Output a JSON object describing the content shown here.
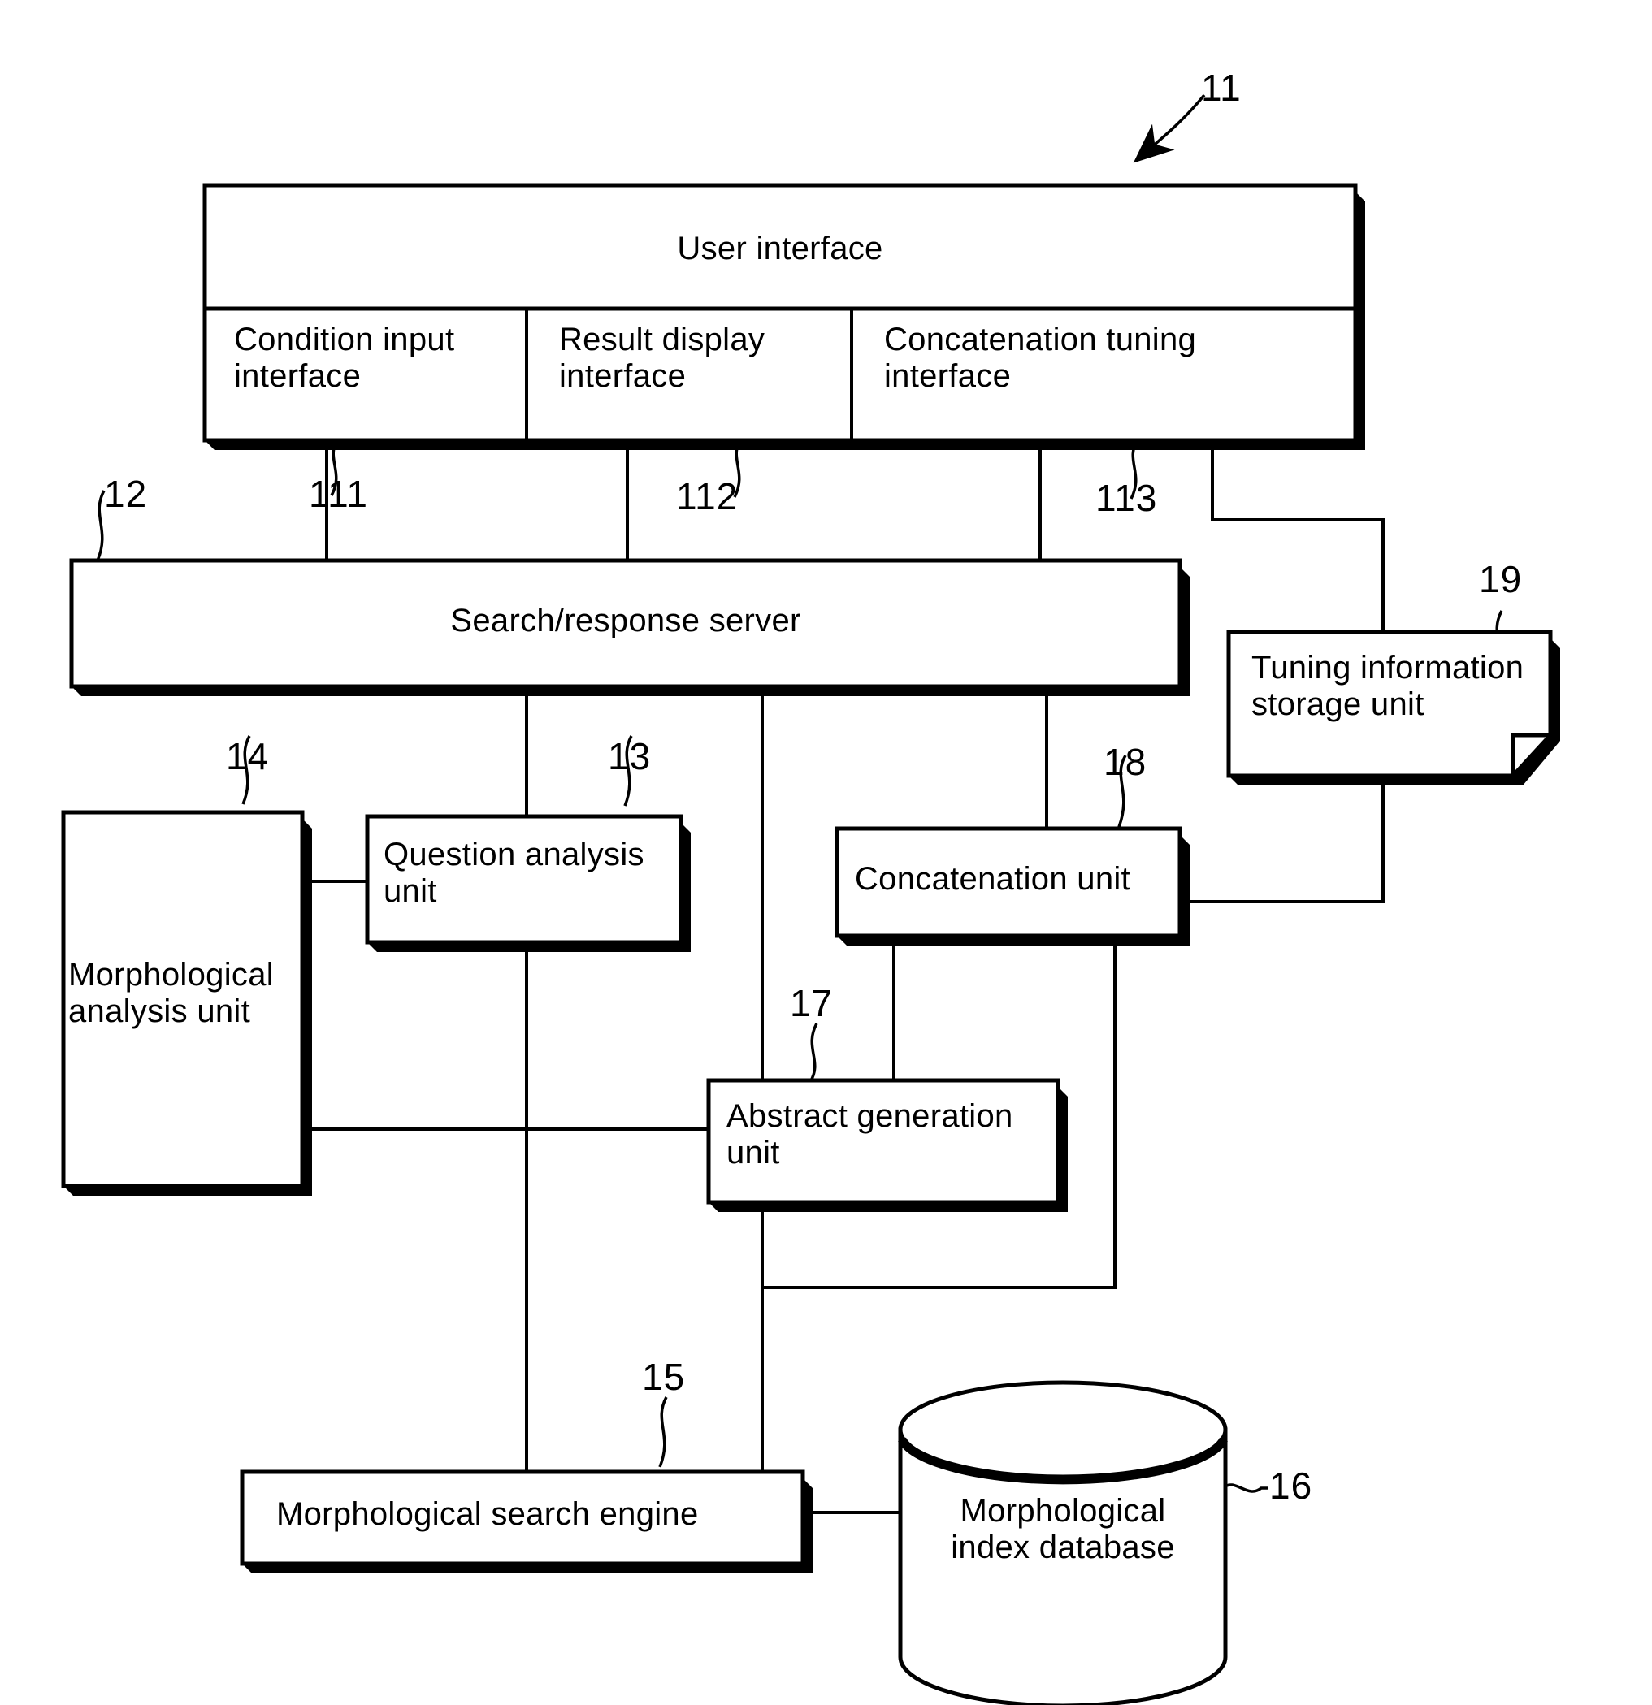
{
  "figure": {
    "title": "Search and response system block diagram",
    "line_color": "#000000",
    "background": "#ffffff"
  },
  "blocks": {
    "user_interface": {
      "label": "User interface",
      "ref": "11"
    },
    "condition_input_interface": {
      "label": "Condition input\ninterface",
      "ref": "111"
    },
    "result_display_interface": {
      "label": "Result display\ninterface",
      "ref": "112"
    },
    "concatenation_tuning_interface": {
      "label": "Concatenation tuning\ninterface",
      "ref": "113"
    },
    "search_response_server": {
      "label": "Search/response server",
      "ref": "12"
    },
    "tuning_information_storage_unit": {
      "label": "Tuning information\nstorage unit",
      "ref": "19"
    },
    "question_analysis_unit": {
      "label": "Question analysis\nunit",
      "ref": "13"
    },
    "morphological_analysis_unit": {
      "label": "Morphological\nanalysis unit",
      "ref": "14"
    },
    "concatenation_unit": {
      "label": "Concatenation unit",
      "ref": "18"
    },
    "abstract_generation_unit": {
      "label": "Abstract generation\nunit",
      "ref": "17"
    },
    "morphological_search_engine": {
      "label": "Morphological search engine",
      "ref": "15"
    },
    "morphological_index_database": {
      "label": "Morphological\nindex database",
      "ref": "16"
    }
  },
  "reference_numerals": {
    "n11": "11",
    "n12": "12",
    "n13": "13",
    "n14": "14",
    "n15": "15",
    "n16": "16",
    "n17": "17",
    "n18": "18",
    "n19": "19",
    "n111": "111",
    "n112": "112",
    "n113": "113"
  }
}
